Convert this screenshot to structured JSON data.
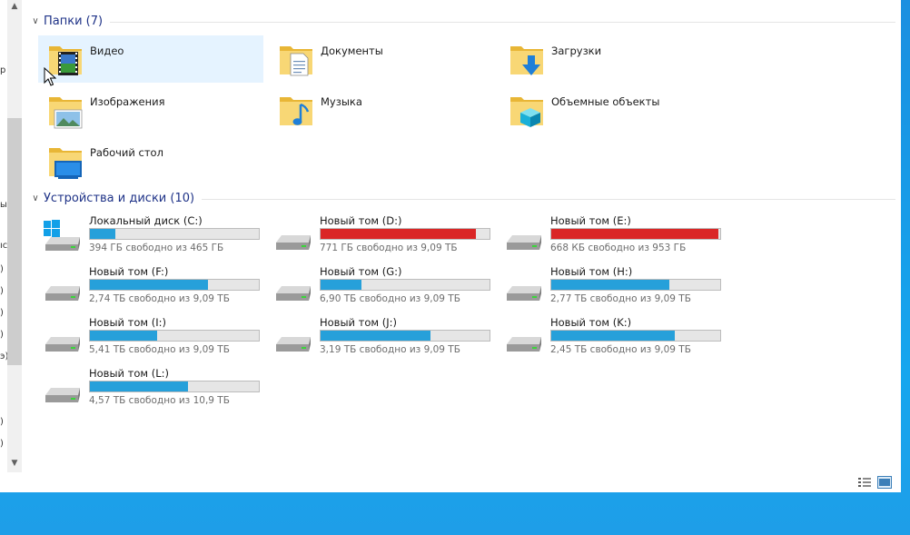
{
  "nav_fragments": [
    "p",
    "ы",
    "ıc",
    ")",
    ")",
    ")",
    ")",
    "э)",
    ")",
    ")"
  ],
  "groups": {
    "folders": {
      "title": "Папки (7)"
    },
    "drives": {
      "title": "Устройства и диски (10)"
    }
  },
  "folders": [
    {
      "name": "Видео",
      "icon": "video-folder-icon"
    },
    {
      "name": "Документы",
      "icon": "documents-folder-icon"
    },
    {
      "name": "Загрузки",
      "icon": "downloads-folder-icon"
    },
    {
      "name": "Изображения",
      "icon": "pictures-folder-icon"
    },
    {
      "name": "Музыка",
      "icon": "music-folder-icon"
    },
    {
      "name": "Объемные объекты",
      "icon": "3d-objects-folder-icon"
    },
    {
      "name": "Рабочий стол",
      "icon": "desktop-folder-icon"
    }
  ],
  "drives": [
    {
      "name": "Локальный диск (C:)",
      "free": "394 ГБ свободно из 465 ГБ",
      "used_fraction": 0.15,
      "status": "normal",
      "icon": "windows-drive-icon"
    },
    {
      "name": "Новый том (D:)",
      "free": "771 ГБ свободно из 9,09 ТБ",
      "used_fraction": 0.92,
      "status": "low",
      "icon": "hard-drive-icon"
    },
    {
      "name": "Новый том (E:)",
      "free": "668 КБ свободно из 953 ГБ",
      "used_fraction": 0.99,
      "status": "low",
      "icon": "hard-drive-icon"
    },
    {
      "name": "Новый том (F:)",
      "free": "2,74 ТБ свободно из 9,09 ТБ",
      "used_fraction": 0.7,
      "status": "normal",
      "icon": "hard-drive-icon"
    },
    {
      "name": "Новый том (G:)",
      "free": "6,90 ТБ свободно из 9,09 ТБ",
      "used_fraction": 0.24,
      "status": "normal",
      "icon": "hard-drive-icon"
    },
    {
      "name": "Новый том (H:)",
      "free": "2,77 ТБ свободно из 9,09 ТБ",
      "used_fraction": 0.7,
      "status": "normal",
      "icon": "hard-drive-icon"
    },
    {
      "name": "Новый том (I:)",
      "free": "5,41 ТБ свободно из 9,09 ТБ",
      "used_fraction": 0.4,
      "status": "normal",
      "icon": "hard-drive-icon"
    },
    {
      "name": "Новый том (J:)",
      "free": "3,19 ТБ свободно из 9,09 ТБ",
      "used_fraction": 0.65,
      "status": "normal",
      "icon": "hard-drive-icon"
    },
    {
      "name": "Новый том (K:)",
      "free": "2,45 ТБ свободно из 9,09 ТБ",
      "used_fraction": 0.73,
      "status": "normal",
      "icon": "hard-drive-icon"
    },
    {
      "name": "Новый том (L:)",
      "free": "4,57 ТБ свободно из 10,9 ТБ",
      "used_fraction": 0.58,
      "status": "normal",
      "icon": "hard-drive-icon"
    }
  ],
  "colors": {
    "bar_normal": "#26a0da",
    "bar_low": "#da2626",
    "selection": "#e5f3ff",
    "group_title": "#1e3287",
    "desktop": "#1a8fe0"
  }
}
